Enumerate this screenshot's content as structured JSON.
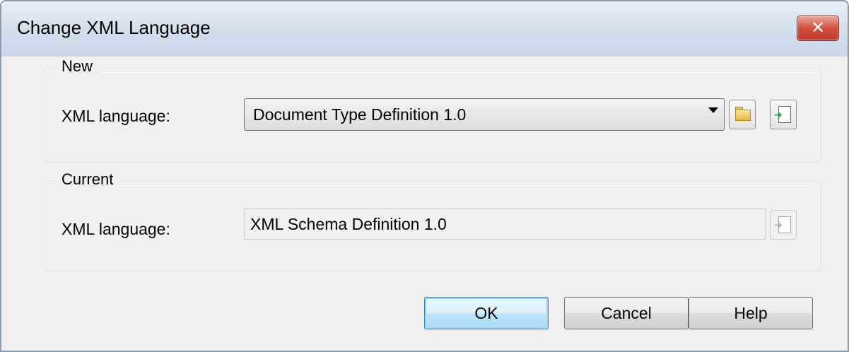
{
  "window": {
    "title": "Change XML Language",
    "close_label": "✕"
  },
  "new_group": {
    "legend": "New",
    "field_label": "XML language:",
    "selected_value": "Document Type Definition 1.0",
    "browse_icon": "folder-icon",
    "properties_icon": "properties-icon"
  },
  "current_group": {
    "legend": "Current",
    "field_label": "XML language:",
    "value": "XML Schema Definition 1.0",
    "properties_icon": "properties-icon"
  },
  "buttons": {
    "ok": "OK",
    "cancel": "Cancel",
    "help": "Help"
  }
}
